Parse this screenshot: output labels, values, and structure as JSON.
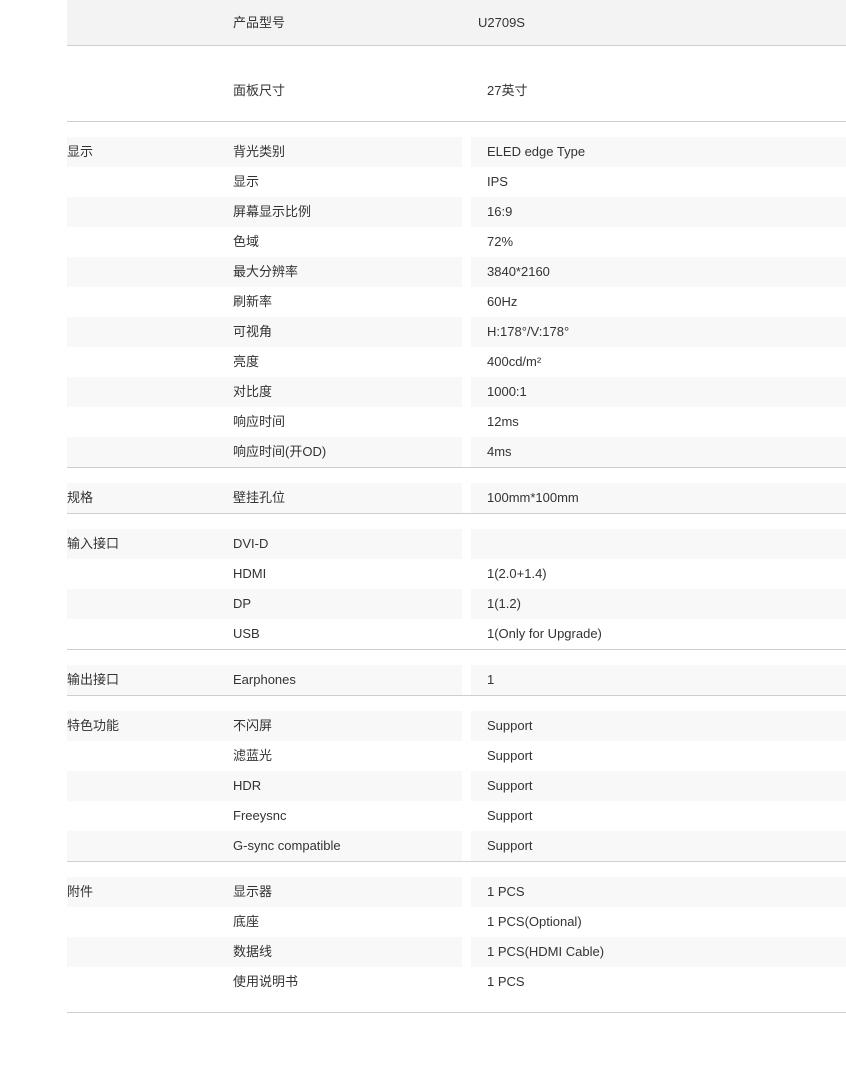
{
  "colors": {
    "text": "#333333",
    "row_shade": "#f8f8f8",
    "banner_shade": "#f3f3f3",
    "divider": "#cfcfcf",
    "page_bg": "#ffffff"
  },
  "spec_table": {
    "columns": [
      "category",
      "name",
      "value"
    ],
    "sections": [
      {
        "id": "model",
        "style": "banner",
        "category": "",
        "rows": [
          {
            "name": "产品型号",
            "value": "U2709S"
          }
        ]
      },
      {
        "id": "panel-size",
        "style": "plain",
        "category": "",
        "rows": [
          {
            "name": "面板尺寸",
            "value": "27英寸"
          }
        ]
      },
      {
        "id": "display",
        "style": "normal",
        "category": "显示",
        "rows": [
          {
            "name": "背光类别",
            "value": "ELED edge Type"
          },
          {
            "name": "显示",
            "value": "IPS"
          },
          {
            "name": "屏幕显示比例",
            "value": "16:9"
          },
          {
            "name": "色域",
            "value": "72%"
          },
          {
            "name": "最大分辨率",
            "value": "3840*2160"
          },
          {
            "name": "刷新率",
            "value": "60Hz"
          },
          {
            "name": "可视角",
            "value": "H:178°/V:178°"
          },
          {
            "name": "亮度",
            "value": "400cd/m²"
          },
          {
            "name": "对比度",
            "value": "1000:1"
          },
          {
            "name": "响应时间",
            "value": "12ms"
          },
          {
            "name": "响应时间(开OD)",
            "value": "4ms"
          }
        ]
      },
      {
        "id": "specification",
        "style": "normal",
        "category": "规格",
        "rows": [
          {
            "name": "壁挂孔位",
            "value": "100mm*100mm"
          }
        ]
      },
      {
        "id": "input-interface",
        "style": "normal",
        "category": "输入接口",
        "rows": [
          {
            "name": "DVI-D",
            "value": ""
          },
          {
            "name": "HDMI",
            "value": "1(2.0+1.4)"
          },
          {
            "name": "DP",
            "value": "1(1.2)"
          },
          {
            "name": "USB",
            "value": "1(Only for Upgrade)"
          }
        ]
      },
      {
        "id": "output-interface",
        "style": "normal",
        "category": "输出接口",
        "rows": [
          {
            "name": "Earphones",
            "value": "1"
          }
        ]
      },
      {
        "id": "features",
        "style": "normal",
        "category": "特色功能",
        "rows": [
          {
            "name": "不闪屏",
            "value": "Support"
          },
          {
            "name": "滤蓝光",
            "value": "Support"
          },
          {
            "name": "HDR",
            "value": "Support"
          },
          {
            "name": "Freeysnc",
            "value": "Support"
          },
          {
            "name": "G-sync compatible",
            "value": "Support"
          }
        ]
      },
      {
        "id": "accessories",
        "style": "normal",
        "category": "附件",
        "rows": [
          {
            "name": "显示器",
            "value": "1 PCS"
          },
          {
            "name": "底座",
            "value": "1 PCS(Optional)"
          },
          {
            "name": "数据线",
            "value": "1 PCS(HDMI Cable)"
          },
          {
            "name": "使用说明书",
            "value": "1 PCS"
          }
        ]
      }
    ]
  }
}
